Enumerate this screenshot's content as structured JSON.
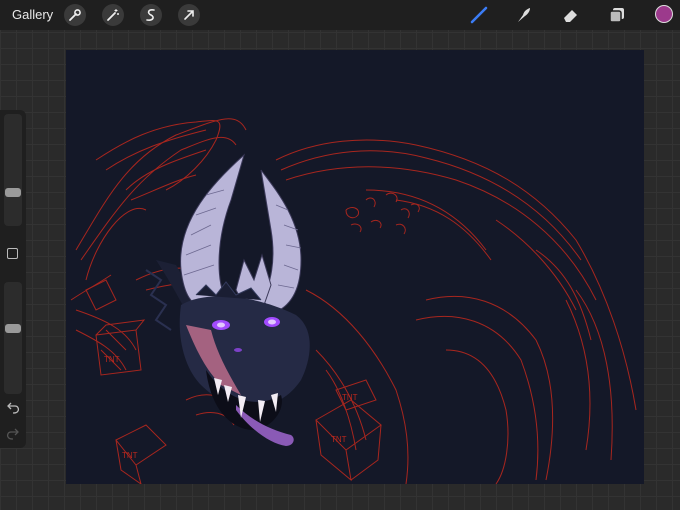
{
  "topbar": {
    "gallery_label": "Gallery",
    "left_tools": [
      "wrench-icon",
      "magic-wand-icon",
      "selection-icon",
      "transform-arrow-icon"
    ],
    "right_tools": [
      "brush-icon",
      "smudge-icon",
      "eraser-icon",
      "layers-icon"
    ],
    "active_tool": "brush-icon",
    "active_tool_color": "#3b7cf5",
    "current_color": "#9c3a8c"
  },
  "sidebar": {
    "brush_size_level": 0.28,
    "opacity_level": 0.59,
    "controls": [
      "brush-size-slider",
      "modify-button",
      "opacity-slider",
      "undo-icon",
      "redo-icon"
    ]
  },
  "canvas": {
    "background_color": "#141828",
    "sketch_color": "#b8281e",
    "sketch_labels": [
      "TNT",
      "TNT",
      "TNT",
      "TNT"
    ],
    "horn_color": "#b9b5d8",
    "eye_color": "#a24bff",
    "head_color": "#252a45"
  }
}
